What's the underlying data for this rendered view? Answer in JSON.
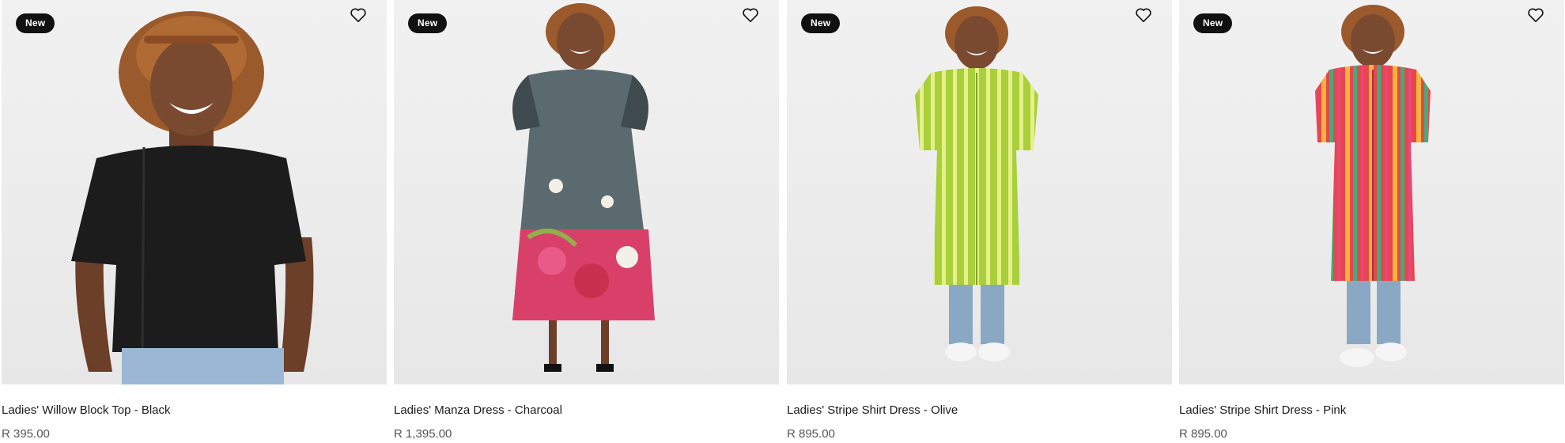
{
  "products": [
    {
      "badge": "New",
      "name": "Ladies' Willow Block Top - Black",
      "price": "R 395.00",
      "wishlist_icon": "heart-outline-icon",
      "colors": {
        "primary": "#1c1c1c",
        "accent": "#2a2a2a"
      }
    },
    {
      "badge": "New",
      "name": "Ladies' Manza Dress - Charcoal",
      "price": "R 1,395.00",
      "wishlist_icon": "heart-outline-icon",
      "colors": {
        "primary": "#5b6a6f",
        "accent": "#d8406a"
      }
    },
    {
      "badge": "New",
      "name": "Ladies' Stripe Shirt Dress - Olive",
      "price": "R 895.00",
      "wishlist_icon": "heart-outline-icon",
      "colors": {
        "primary": "#a9cf3a",
        "accent": "#e6f08a"
      }
    },
    {
      "badge": "New",
      "name": "Ladies' Stripe Shirt Dress - Pink",
      "price": "R 895.00",
      "wishlist_icon": "heart-outline-icon",
      "colors": {
        "primary": "#e8464f",
        "accent": "#f2b43a"
      }
    }
  ]
}
